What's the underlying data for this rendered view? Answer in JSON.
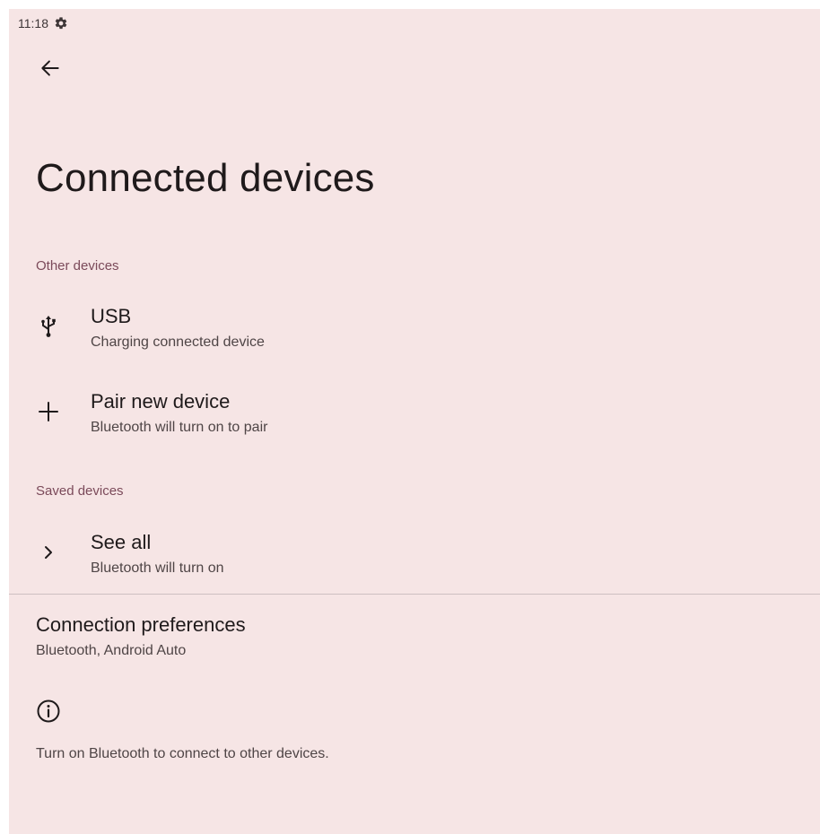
{
  "status_bar": {
    "time": "11:18",
    "icon": "gear-icon"
  },
  "header": {
    "back_icon": "back-arrow-icon",
    "title": "Connected devices"
  },
  "sections": {
    "other_devices": {
      "header": "Other devices",
      "items": [
        {
          "icon": "usb-icon",
          "title": "USB",
          "summary": "Charging connected device"
        },
        {
          "icon": "plus-icon",
          "title": "Pair new device",
          "summary": "Bluetooth will turn on to pair"
        }
      ]
    },
    "saved_devices": {
      "header": "Saved devices",
      "items": [
        {
          "icon": "chevron-right-icon",
          "title": "See all",
          "summary": "Bluetooth will turn on"
        }
      ]
    }
  },
  "connection_preferences": {
    "title": "Connection preferences",
    "summary": "Bluetooth, Android Auto"
  },
  "footer": {
    "icon": "info-icon",
    "text": "Turn on Bluetooth to connect to other devices."
  },
  "colors": {
    "background": "#f6e5e5",
    "section_header": "#7b4a5a",
    "primary_text": "#1f1a1b",
    "secondary_text": "#4f4546",
    "divider": "#cdbfc1"
  }
}
